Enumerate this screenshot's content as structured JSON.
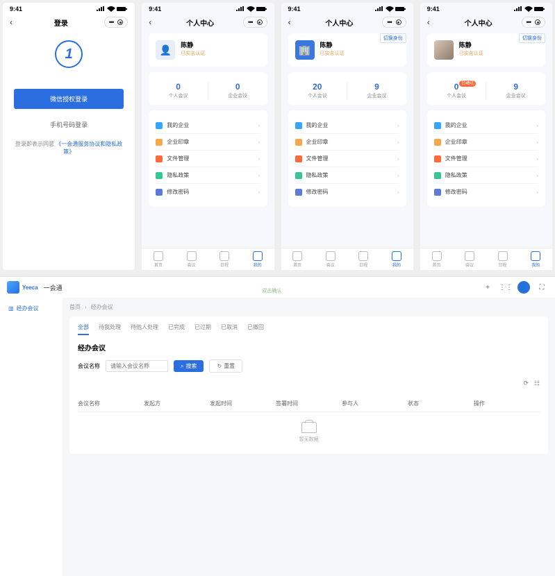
{
  "status_time": "9:41",
  "mob_login": {
    "title": "登录",
    "wechat_btn": "微信授权登录",
    "phone_btn": "手机号码登录",
    "agree_prefix": "登录即表示同意",
    "agree_link": "《一会通服务协议和隐私政策》"
  },
  "profile": {
    "title": "个人中心",
    "name": "陈静",
    "auth_tag": "已实名认证",
    "switch": "切换身份",
    "approved_badge": "已通过",
    "stat_personal": "个人会议",
    "stat_company": "企业会议"
  },
  "counts": {
    "p2": {
      "a": "0",
      "b": "0"
    },
    "p3": {
      "a": "20",
      "b": "9"
    },
    "p4": {
      "a": "0",
      "b": "9"
    }
  },
  "menu": [
    {
      "label": "我的企业",
      "c": "#36a6ff"
    },
    {
      "label": "企业印章",
      "c": "#f6a94c"
    },
    {
      "label": "文件管理",
      "c": "#ff6a3d"
    },
    {
      "label": "隐私政策",
      "c": "#37c694"
    },
    {
      "label": "修改密码",
      "c": "#5c7bd9"
    }
  ],
  "bottom_tabs": [
    "首页",
    "会议",
    "日程",
    "我的"
  ],
  "desktop": {
    "brand": "Yeeca",
    "appname": "一会通",
    "side_item": "经办会议",
    "crumb_home": "首页",
    "crumb_current": "经办会议",
    "center_hint": "双击确认",
    "tabs": [
      "全部",
      "待我处理",
      "待他人处理",
      "已完成",
      "已过期",
      "已取消",
      "已撤回"
    ],
    "panel_title": "经办会议",
    "search_label": "会议名称",
    "search_placeholder": "请输入会议名称",
    "btn_search": "搜索",
    "btn_reset": "重置",
    "cols": [
      "会议名称",
      "发起方",
      "发起时间",
      "签署时间",
      "参与人",
      "状态",
      "操作"
    ],
    "empty": "暂无数据"
  }
}
